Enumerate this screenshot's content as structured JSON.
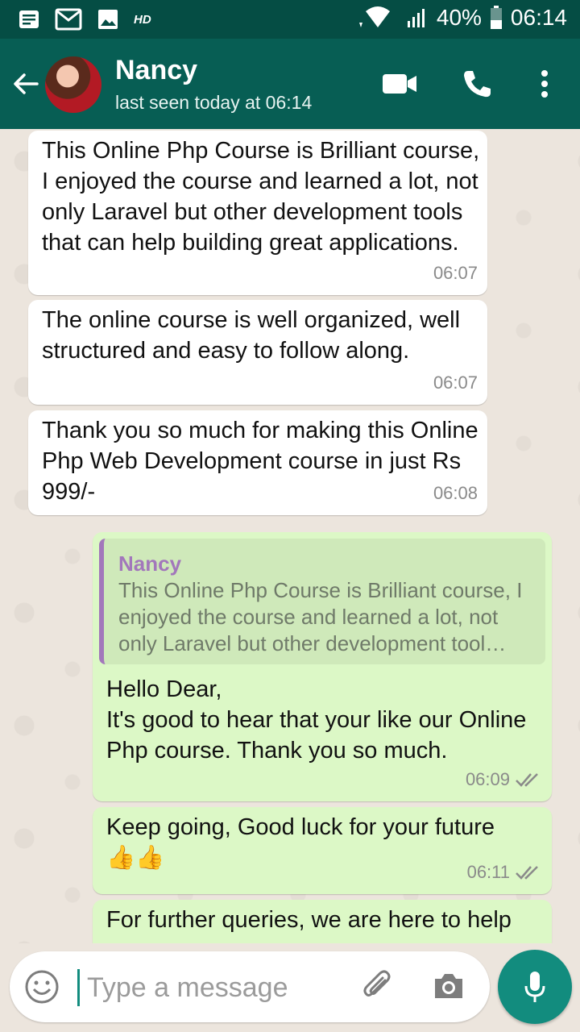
{
  "status_bar": {
    "hd_label": "HD",
    "battery": "40%",
    "time": "06:14",
    "icons": [
      "notes-icon",
      "gmail-icon",
      "image-icon",
      "wifi-icon",
      "signal-icon",
      "battery-icon"
    ]
  },
  "header": {
    "name": "Nancy",
    "status": "last seen today at 06:14",
    "icons": [
      "back-arrow-icon",
      "video-call-icon",
      "phone-icon",
      "more-vert-icon"
    ]
  },
  "messages": [
    {
      "dir": "in",
      "text": "This Online Php Course is Brilliant course,  I enjoyed the course and learned a lot, not only Laravel but other development tools that can help building great applications.",
      "time": "06:07"
    },
    {
      "dir": "in",
      "text": "The online course is well organized, well structured and easy to follow along.",
      "time": "06:07"
    },
    {
      "dir": "in",
      "text": "Thank you so much for making this Online Php Web Development course in just Rs 999/-",
      "time": "06:08"
    },
    {
      "dir": "out",
      "quote_name": "Nancy",
      "quote_text": "This Online Php Course is Brilliant course, I enjoyed the course and learned a lot, not only Laravel but other development tool…",
      "text": "Hello Dear,\nIt's good to hear that your like our Online Php course. Thank you so much.",
      "time": "06:09"
    },
    {
      "dir": "out",
      "text": "Keep going, Good luck for your future\n👍👍",
      "time": "06:11"
    },
    {
      "dir": "out",
      "text": "For further queries, we are here to help",
      "time": ""
    }
  ],
  "composer": {
    "placeholder": "Type a message",
    "icons": [
      "emoji-icon",
      "attach-icon",
      "camera-icon",
      "mic-icon"
    ]
  },
  "colors": {
    "status_bar": "#054d44",
    "app_bar": "#075e54",
    "outgoing_bubble": "#dcf8c6",
    "incoming_bubble": "#ffffff",
    "accent": "#128c7e",
    "quote_name": "#a277bb",
    "read_ticks": "#8a8a8a"
  }
}
